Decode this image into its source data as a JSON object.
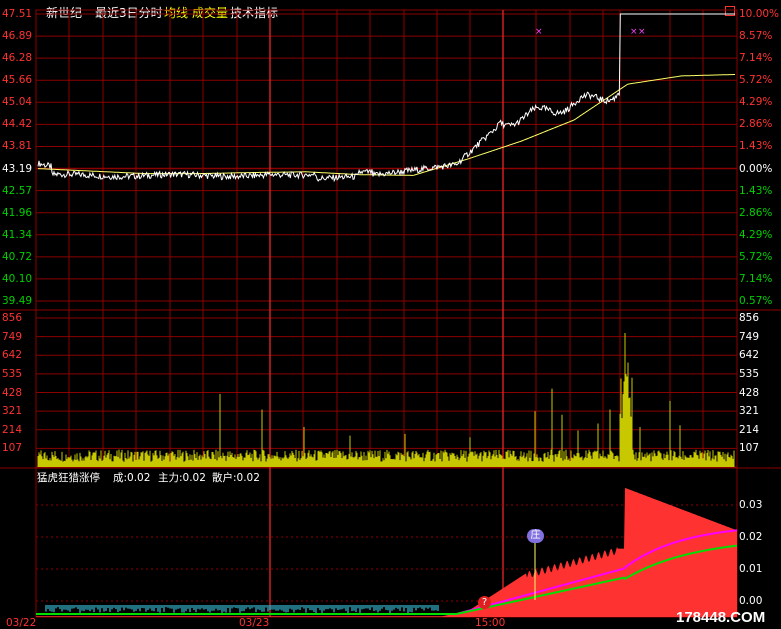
{
  "header": {
    "stock_name": "新世纪",
    "period": "最近3日分时",
    "avg_line": "均线",
    "volume": "成交量",
    "indicator": "技术指标"
  },
  "colors": {
    "background": "#000000",
    "grid": "#8B0000",
    "up": "#FF3232",
    "down": "#00D000",
    "flat": "#FFFFFF",
    "avg_line": "#FFFF66",
    "volume_bar": "#C8C800",
    "ma_magenta": "#FF00FF",
    "ma_green": "#00E000",
    "cyan_bars": "#40E0FF"
  },
  "price_axis": {
    "left": [
      "47.51",
      "46.89",
      "46.28",
      "45.66",
      "45.04",
      "44.42",
      "43.81",
      "43.19",
      "42.57",
      "41.96",
      "41.34",
      "40.72",
      "40.10",
      "39.49"
    ],
    "right": [
      "10.00%",
      "8.57%",
      "7.14%",
      "5.72%",
      "4.29%",
      "2.86%",
      "1.43%",
      "0.00%",
      "1.43%",
      "2.86%",
      "4.29%",
      "5.72%",
      "7.14%",
      "0.57%"
    ],
    "prev_close": 43.19
  },
  "volume_axis": {
    "left": [
      "856",
      "749",
      "642",
      "535",
      "428",
      "321",
      "214",
      "107"
    ],
    "right": [
      "856",
      "749",
      "642",
      "535",
      "428",
      "321",
      "214",
      "107"
    ]
  },
  "indicator_panel": {
    "title": "猛虎狂猎涨停",
    "cheng_label": "成:0.02",
    "zhuli_label": "主力:0.02",
    "sanhu_label": "散户:0.02",
    "axis": [
      "0.03",
      "0.02",
      "0.01",
      "0.00"
    ],
    "marker_tag": "庄",
    "marker_icon": "?"
  },
  "date_axis": [
    "03/22",
    "03/23",
    "15:00"
  ],
  "watermark": "178448.COM",
  "chart_data": {
    "type": "line",
    "title": "最近3日分时",
    "x_categories": [
      "03/22",
      "03/23",
      "15:00"
    ],
    "series": [
      {
        "name": "均线",
        "values": [
          43.19,
          43.12,
          43.05,
          43.05,
          43.08,
          43.1,
          43.02,
          43.0,
          43.45,
          43.95,
          44.55,
          45.55,
          45.78,
          45.82
        ]
      },
      {
        "name": "成交量",
        "values": [
          107,
          110,
          90,
          100,
          120,
          214,
          95,
          100,
          170,
          321,
          214,
          230,
          749,
          200
        ]
      }
    ],
    "ylim": [
      39.49,
      47.51
    ],
    "volume_ylim": [
      0,
      856
    ],
    "indicator_ylim": [
      0,
      0.035
    ]
  }
}
